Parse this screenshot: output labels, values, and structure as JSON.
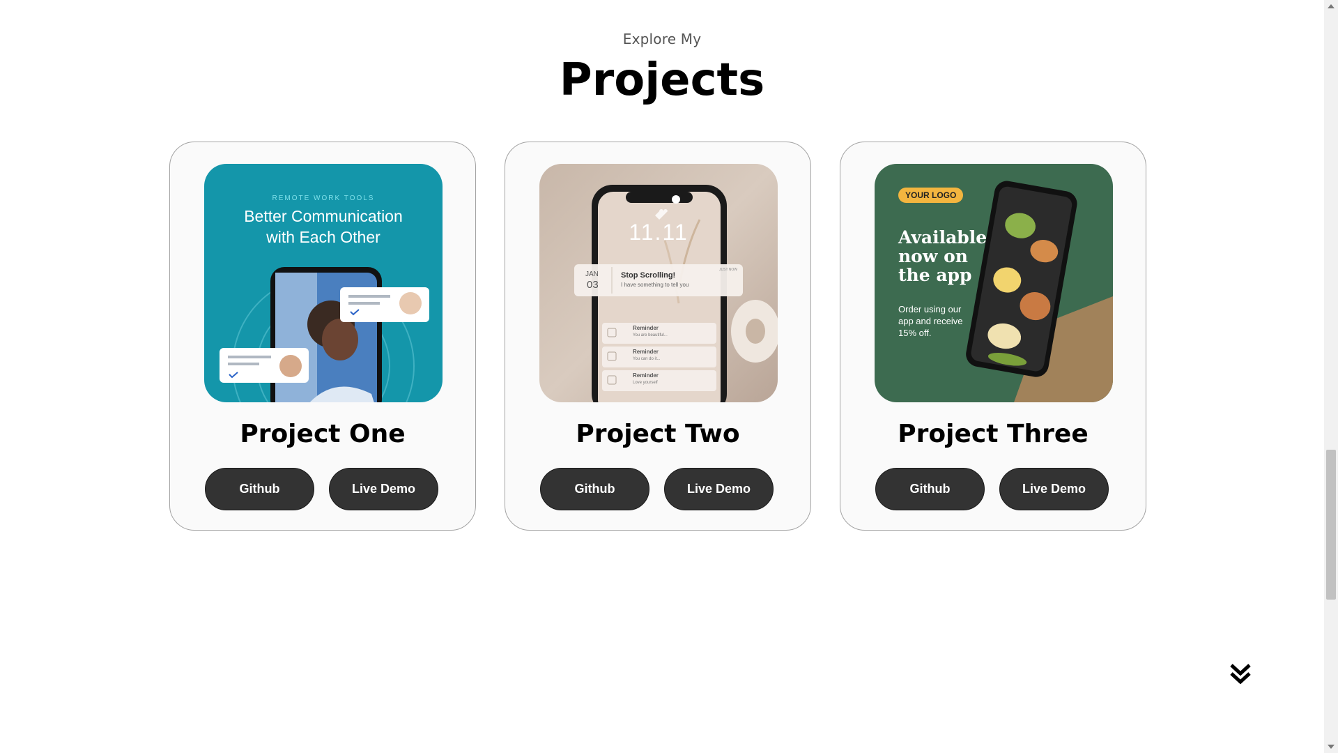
{
  "section": {
    "subtitle": "Explore My",
    "title": "Projects"
  },
  "projects": [
    {
      "name": "Project One",
      "github_label": "Github",
      "demo_label": "Live Demo",
      "image": {
        "eyebrow": "REMOTE WORK TOOLS",
        "headline_line1": "Better Communication",
        "headline_line2": "with Each Other"
      }
    },
    {
      "name": "Project Two",
      "github_label": "Github",
      "demo_label": "Live Demo",
      "image": {
        "time": "11.11",
        "notif_month": "JAN",
        "notif_day": "03",
        "notif_title": "Stop Scrolling!",
        "notif_body": "I have something to tell you",
        "notif_tag": "JUST NOW",
        "reminders": [
          {
            "title": "Reminder",
            "body": "You are beautiful..."
          },
          {
            "title": "Reminder",
            "body": "You can do it..."
          },
          {
            "title": "Reminder",
            "body": "Love yourself"
          }
        ]
      }
    },
    {
      "name": "Project Three",
      "github_label": "Github",
      "demo_label": "Live Demo",
      "image": {
        "logo": "YOUR LOGO",
        "headline_line1": "Available",
        "headline_line2": "now on",
        "headline_line3": "the app",
        "body": "Order using our app and receive 15% off."
      }
    }
  ],
  "icons": {
    "scroll_down": "double-chevron-down-icon"
  },
  "colors": {
    "button_bg": "#333333",
    "card_border": "#a3a3a3",
    "card_bg": "#fafafa",
    "thumb1_bg": "#1496aa",
    "thumb3_bg": "#3d6b50"
  }
}
